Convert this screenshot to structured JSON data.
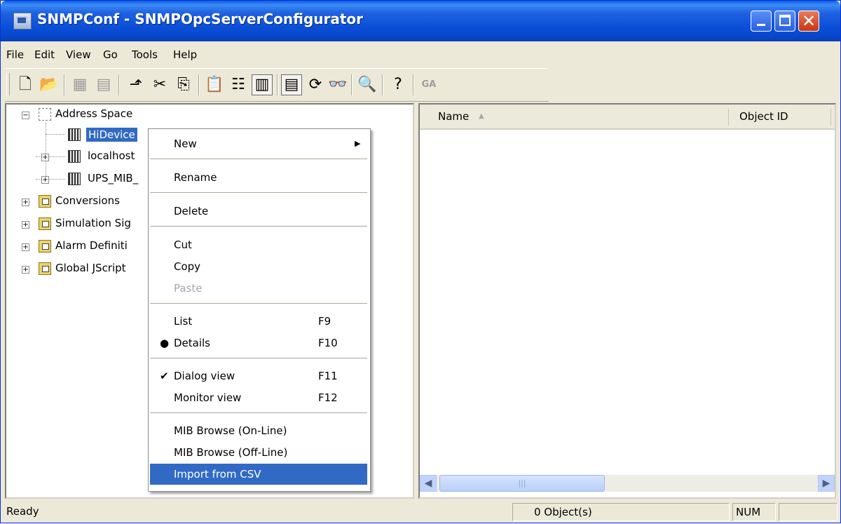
{
  "window": {
    "title": "SNMPConf - SNMPOpcServerConfigurator"
  },
  "menubar": {
    "items": [
      "File",
      "Edit",
      "View",
      "Go",
      "Tools",
      "Help"
    ]
  },
  "toolbar": {
    "ga_label": "GA"
  },
  "tree": {
    "root": "Address Space",
    "children": [
      "HiDevice",
      "localhost",
      "UPS_MIB_"
    ],
    "others": [
      "Conversions",
      "Simulation Sig",
      "Alarm Definiti",
      "Global JScript"
    ]
  },
  "list": {
    "columns": [
      "Name",
      "Object ID"
    ],
    "sort_indicator": "▲"
  },
  "context_menu": {
    "new": "New",
    "rename": "Rename",
    "delete": "Delete",
    "cut": "Cut",
    "copy": "Copy",
    "paste": "Paste",
    "list": "List",
    "list_key": "F9",
    "details": "Details",
    "details_key": "F10",
    "dialog_view": "Dialog view",
    "dialog_key": "F11",
    "monitor_view": "Monitor view",
    "monitor_key": "F12",
    "mib_online": "MIB Browse (On-Line)",
    "mib_offline": "MIB Browse (Off-Line)",
    "import_csv": "Import from CSV"
  },
  "statusbar": {
    "ready": "Ready",
    "objects": "0 Object(s)",
    "num": "NUM"
  },
  "colors": {
    "title_bar": "#0a4fd8",
    "selection": "#316ac5",
    "window_bg": "#ece9d8"
  }
}
